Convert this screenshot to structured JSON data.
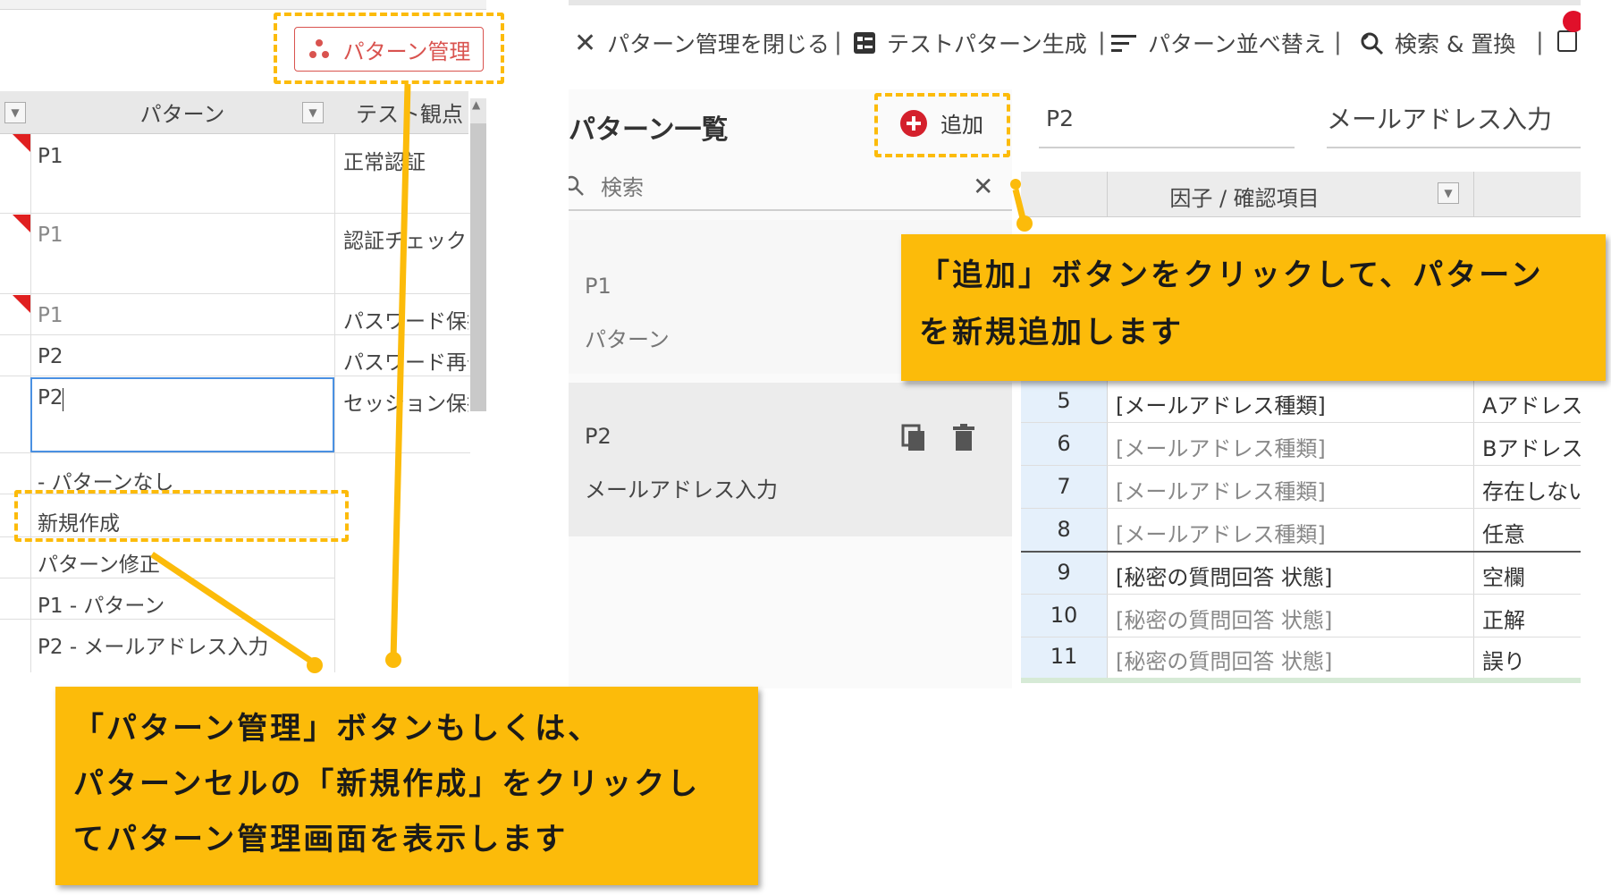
{
  "left": {
    "pattern_mgmt_button": "パターン管理",
    "col_pattern": "パターン",
    "col_test_viewpoint": "テスト観点",
    "rows": [
      {
        "pattern": "P1",
        "viewpoint": "正常認証",
        "muted": false
      },
      {
        "pattern": "P1",
        "viewpoint": "認証チェック",
        "muted": true
      },
      {
        "pattern": "P1",
        "viewpoint": "パスワード保持",
        "muted": true
      },
      {
        "pattern": "P2",
        "viewpoint": "パスワード再発",
        "muted": false
      },
      {
        "pattern": "P2",
        "viewpoint": "セッション保持",
        "muted": false
      }
    ],
    "dropdown": [
      "- パターンなし",
      "新規作成",
      "パターン修正",
      "P1 - パターン",
      "P2 - メールアドレス入力"
    ]
  },
  "right": {
    "toolbar": {
      "close": "パターン管理を閉じる",
      "generate": "テストパターン生成",
      "sort": "パターン並べ替え",
      "search_replace": "検索 & 置換"
    },
    "list_title": "パターン一覧",
    "add_button": "追加",
    "search_placeholder": "検索",
    "patterns": [
      {
        "id": "P1",
        "name": "パターン"
      },
      {
        "id": "P2",
        "name": "メールアドレス入力"
      }
    ],
    "detail": {
      "id": "P2",
      "name": "メールアドレス入力",
      "col_factor": "因子 / 確認項目",
      "rows": [
        {
          "no": "5",
          "factor": "[メールアドレス種類]",
          "value": "Aアドレス",
          "muted": false
        },
        {
          "no": "6",
          "factor": "[メールアドレス種類]",
          "value": "Bアドレス",
          "muted": true
        },
        {
          "no": "7",
          "factor": "[メールアドレス種類]",
          "value": "存在しないアド",
          "muted": true
        },
        {
          "no": "8",
          "factor": "[メールアドレス種類]",
          "value": "任意",
          "muted": true
        },
        {
          "no": "9",
          "factor": "[秘密の質問回答 状態]",
          "value": "空欄",
          "muted": false
        },
        {
          "no": "10",
          "factor": "[秘密の質問回答 状態]",
          "value": "正解",
          "muted": true
        },
        {
          "no": "11",
          "factor": "[秘密の質問回答 状態]",
          "value": "誤り",
          "muted": true
        }
      ]
    }
  },
  "callouts": {
    "right_line1": "「追加」ボタンをクリックして、パターン",
    "right_line2": "を新規追加します",
    "bottom_line1": "「パターン管理」ボタンもしくは、",
    "bottom_line2": "パターンセルの「新規作成」をクリックし",
    "bottom_line3": "てパターン管理画面を表示します"
  },
  "colors": {
    "callout": "#fcbb0a",
    "accent_red": "#d9534f",
    "selected_blue": "#4a90e2"
  },
  "icons": [
    "pattern-dots-icon",
    "filter-icon",
    "close-icon",
    "grid-icon",
    "sort-icon",
    "search-replace-icon",
    "add-circle-icon",
    "search-icon",
    "copy-icon",
    "trash-icon"
  ]
}
